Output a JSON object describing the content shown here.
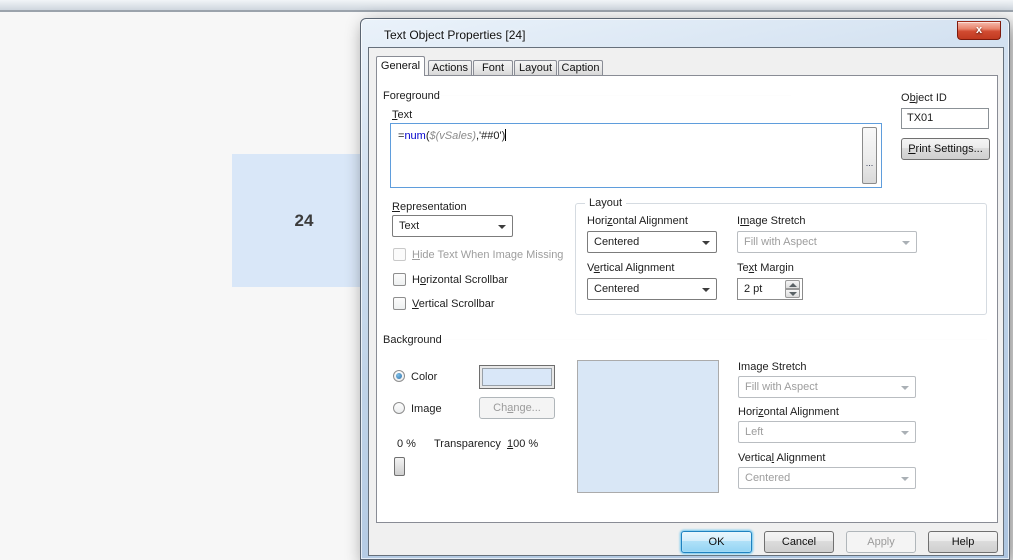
{
  "desktop": {
    "text_object_value": "24"
  },
  "dialog": {
    "title": "Text Object Properties [24]",
    "close_label": "x",
    "tabs": [
      {
        "label": "General"
      },
      {
        "label": "Actions"
      },
      {
        "label": "Font"
      },
      {
        "label": "Layout"
      },
      {
        "label": "Caption"
      }
    ],
    "foreground": {
      "header": "Foreground",
      "text_label": "&Text",
      "formula": {
        "eq": "=",
        "func": "num",
        "paren": "(",
        "variable": "$(vSales)",
        "tail": ",'##0')"
      },
      "ellipsis_label": "...",
      "object_id": {
        "label": "O&bject ID",
        "value": "TX01"
      },
      "print_settings_label": "&Print Settings...",
      "representation": {
        "label": "&Representation",
        "value": "Text"
      },
      "checkboxes": [
        {
          "label": "&Hide Text When Image Missing"
        },
        {
          "label": "H&orizontal Scrollbar"
        },
        {
          "label": "&Vertical Scrollbar"
        }
      ]
    },
    "layout_group": {
      "title": "Layout",
      "horizontal_alignment": {
        "label": "Hori&zontal Alignment",
        "value": "Centered"
      },
      "image_stretch": {
        "label": "I&mage Stretch",
        "value": "Fill with Aspect"
      },
      "vertical_alignment": {
        "label": "V&ertical Alignment",
        "value": "Centered"
      },
      "text_margin": {
        "label": "Te&xt Margin",
        "value": "2 pt"
      }
    },
    "background": {
      "header": "Background",
      "color_label": "Color",
      "image_label": "Image",
      "change_label": "Ch&ange...",
      "transparency": {
        "min": "0 %",
        "label": "Transparency",
        "max": "&100 %"
      },
      "image_stretch": {
        "label": "Ima&ge Stretch",
        "value": "Fill with Aspect"
      },
      "horizontal_alignment": {
        "label": "Hori&zontal Alignment",
        "value": "Left"
      },
      "vertical_alignment": {
        "label": "Vertica&l Alignment",
        "value": "Centered"
      }
    },
    "footer": {
      "ok": "OK",
      "cancel": "Cancel",
      "apply": "Apply",
      "help": "Help"
    },
    "accent_colors": {
      "object_fill": "#d9e7f8",
      "formula_function": "#0000cc",
      "close_red": "#c03a20"
    }
  }
}
